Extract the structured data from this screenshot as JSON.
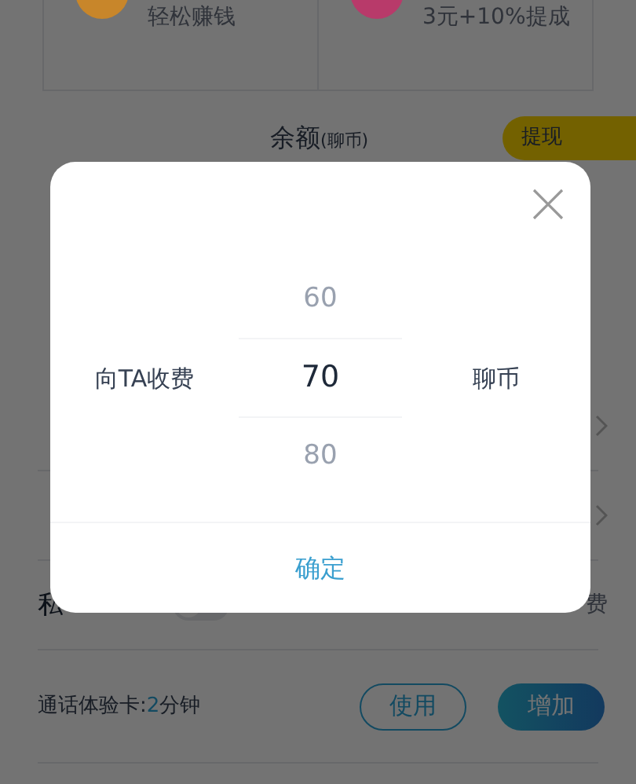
{
  "earn_items": [
    {
      "caption": "轻松赚钱",
      "color": "#c8862a"
    },
    {
      "caption": "3元+10%提成",
      "color": "#b83a6a"
    }
  ],
  "balance": {
    "label": "余额",
    "unit": "(聊币)",
    "withdraw_button": "提现"
  },
  "rows": [
    {
      "kind": "link"
    },
    {
      "kind": "link"
    },
    {
      "kind": "toggle",
      "label": "私",
      "trailing": "费",
      "on": false
    }
  ],
  "trial_card": {
    "label": "通话体验卡:",
    "value": "2",
    "unit": "分钟",
    "use_button": "使用",
    "add_button": "增加"
  },
  "dialog": {
    "label": "向TA收费",
    "unit": "聊币",
    "picker": [
      {
        "value": "60",
        "selected": false
      },
      {
        "value": "70",
        "selected": true
      },
      {
        "value": "80",
        "selected": false
      }
    ],
    "confirm_button": "确定"
  }
}
